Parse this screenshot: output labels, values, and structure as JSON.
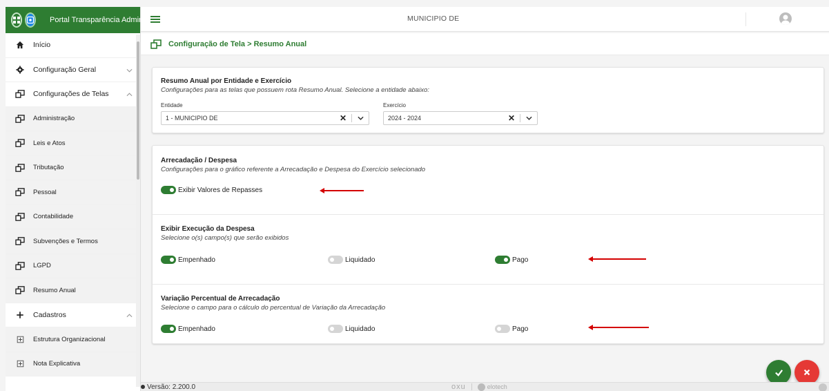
{
  "app": {
    "title": "Portal Transparência Admin",
    "municipality": "MUNICIPIO DE"
  },
  "sidebar": {
    "items": [
      {
        "label": "Início",
        "icon": "home-icon",
        "type": "top"
      },
      {
        "label": "Configuração Geral",
        "icon": "gear-icon",
        "type": "top",
        "chevron": "down"
      },
      {
        "label": "Configurações de Telas",
        "icon": "window-icon",
        "type": "top",
        "chevron": "up"
      },
      {
        "label": "Administração",
        "icon": "window-icon",
        "type": "sub"
      },
      {
        "label": "Leis e Atos",
        "icon": "window-icon",
        "type": "sub"
      },
      {
        "label": "Tributação",
        "icon": "window-icon",
        "type": "sub"
      },
      {
        "label": "Pessoal",
        "icon": "window-icon",
        "type": "sub"
      },
      {
        "label": "Contabilidade",
        "icon": "window-icon",
        "type": "sub"
      },
      {
        "label": "Subvenções e Termos",
        "icon": "window-icon",
        "type": "sub"
      },
      {
        "label": "LGPD",
        "icon": "window-icon",
        "type": "sub"
      },
      {
        "label": "Resumo Anual",
        "icon": "window-icon",
        "type": "sub"
      },
      {
        "label": "Cadastros",
        "icon": "plus-icon",
        "type": "top",
        "chevron": "up"
      },
      {
        "label": "Estrutura Organizacional",
        "icon": "plus-box-icon",
        "type": "sub"
      },
      {
        "label": "Nota Explicativa",
        "icon": "plus-box-icon",
        "type": "sub"
      }
    ]
  },
  "breadcrumb": {
    "text": "Configuração de Tela > Resumo Anual"
  },
  "resumo": {
    "title": "Resumo Anual por Entidade e Exercício",
    "description": "Configurações para as telas que possuem rota Resumo Anual. Selecione a entidade abaixo:",
    "entidade_label": "Entidade",
    "entidade_value": "1 - MUNICIPIO DE",
    "exercicio_label": "Exercício",
    "exercicio_value": "2024 - 2024",
    "clear_glyph": "✕"
  },
  "arrecadacao": {
    "title": "Arrecadação / Despesa",
    "description": "Configurações para o gráfico referente a Arrecadação e Despesa do Exercício selecionado",
    "toggle_label": "Exibir Valores de Repasses",
    "toggle_on": true
  },
  "execucao": {
    "title": "Exibir Execução da Despesa",
    "description": "Selecione o(s) campo(s) que serão exibidos",
    "options": [
      {
        "label": "Empenhado",
        "on": true
      },
      {
        "label": "Liquidado",
        "on": false
      },
      {
        "label": "Pago",
        "on": true
      }
    ]
  },
  "variacao": {
    "title": "Variação Percentual de Arrecadação",
    "description": "Selecione o campo para o cálculo do percentual de Variação da Arrecadação",
    "options": [
      {
        "label": "Empenhado",
        "on": true
      },
      {
        "label": "Liquidado",
        "on": false
      },
      {
        "label": "Pago",
        "on": false
      }
    ]
  },
  "footer": {
    "version": "Versão: 2.200.0",
    "brand1": "oxu",
    "brand2": "elotech"
  },
  "colors": {
    "primary": "#2e7d32",
    "danger": "#e53935",
    "annotation_arrow": "#d40000"
  }
}
